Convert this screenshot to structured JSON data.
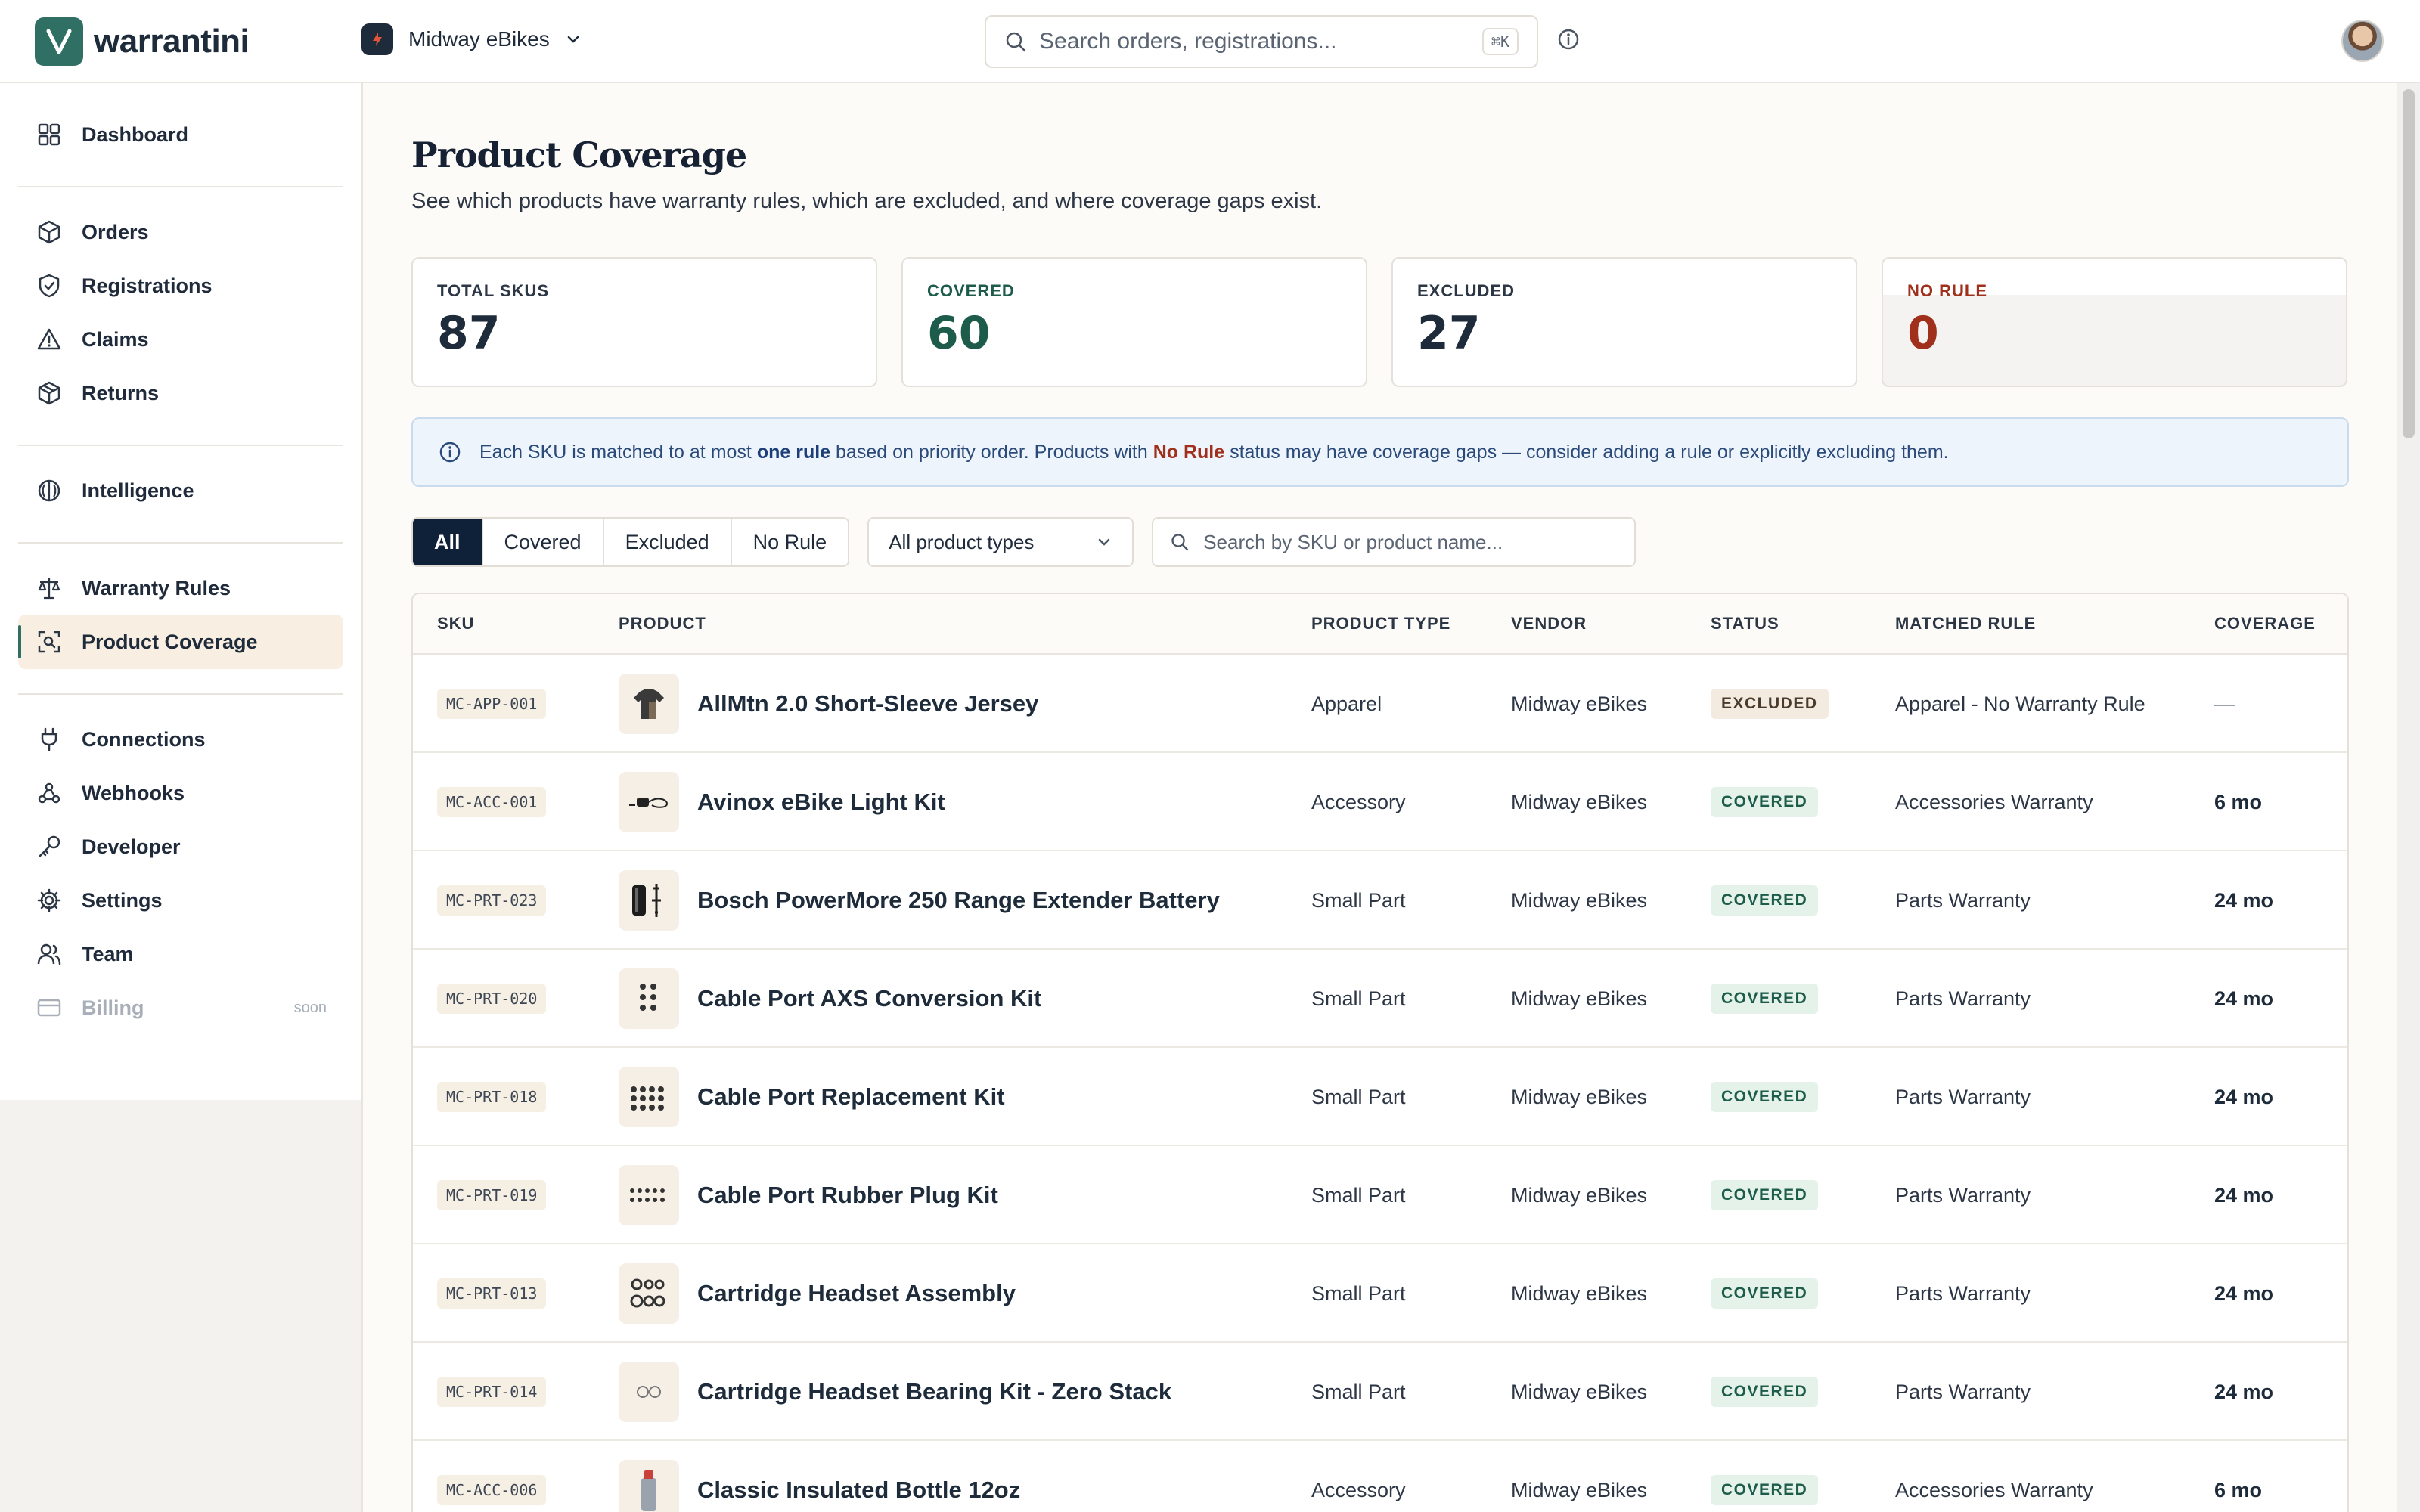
{
  "app": {
    "name": "warrantini"
  },
  "store": {
    "name": "Midway eBikes"
  },
  "search": {
    "placeholder": "Search orders, registrations...",
    "shortcut": "⌘K"
  },
  "sidebar": {
    "items": [
      {
        "label": "Dashboard",
        "icon": "grid-icon"
      },
      {
        "label": "Orders",
        "icon": "box-icon"
      },
      {
        "label": "Registrations",
        "icon": "shield-check-icon"
      },
      {
        "label": "Claims",
        "icon": "warning-icon"
      },
      {
        "label": "Returns",
        "icon": "package-return-icon"
      },
      {
        "label": "Intelligence",
        "icon": "brain-icon"
      },
      {
        "label": "Warranty Rules",
        "icon": "scale-icon"
      },
      {
        "label": "Product Coverage",
        "icon": "scan-search-icon",
        "active": true
      },
      {
        "label": "Connections",
        "icon": "plug-icon"
      },
      {
        "label": "Webhooks",
        "icon": "webhook-icon"
      },
      {
        "label": "Developer",
        "icon": "key-icon"
      },
      {
        "label": "Settings",
        "icon": "gear-icon"
      },
      {
        "label": "Team",
        "icon": "users-icon"
      },
      {
        "label": "Billing",
        "icon": "credit-card-icon",
        "badge": "soon",
        "disabled": true
      }
    ]
  },
  "page": {
    "title": "Product Coverage",
    "subtitle": "See which products have warranty rules, which are excluded, and where coverage gaps exist."
  },
  "stats": [
    {
      "label": "TOTAL SKUS",
      "value": "87"
    },
    {
      "label": "COVERED",
      "value": "60"
    },
    {
      "label": "EXCLUDED",
      "value": "27"
    },
    {
      "label": "NO RULE",
      "value": "0"
    }
  ],
  "notice": {
    "part1": "Each SKU is matched to at most ",
    "bold1": "one rule",
    "part2": " based on priority order. Products with ",
    "bold2": "No Rule",
    "part3": " status may have coverage gaps — consider adding a rule or explicitly excluding them."
  },
  "filters": {
    "tabs": [
      "All",
      "Covered",
      "Excluded",
      "No Rule"
    ],
    "product_type": "All product types",
    "sku_search_placeholder": "Search by SKU or product name..."
  },
  "table": {
    "columns": [
      "SKU",
      "PRODUCT",
      "PRODUCT TYPE",
      "VENDOR",
      "STATUS",
      "MATCHED RULE",
      "COVERAGE"
    ],
    "rows": [
      {
        "sku": "MC-APP-001",
        "product": "AllMtn 2.0 Short-Sleeve Jersey",
        "type": "Apparel",
        "vendor": "Midway eBikes",
        "status": "EXCLUDED",
        "rule": "Apparel - No Warranty Rule",
        "coverage": "—"
      },
      {
        "sku": "MC-ACC-001",
        "product": "Avinox eBike Light Kit",
        "type": "Accessory",
        "vendor": "Midway eBikes",
        "status": "COVERED",
        "rule": "Accessories Warranty",
        "coverage": "6 mo"
      },
      {
        "sku": "MC-PRT-023",
        "product": "Bosch PowerMore 250 Range Extender Battery",
        "type": "Small Part",
        "vendor": "Midway eBikes",
        "status": "COVERED",
        "rule": "Parts Warranty",
        "coverage": "24 mo"
      },
      {
        "sku": "MC-PRT-020",
        "product": "Cable Port AXS Conversion Kit",
        "type": "Small Part",
        "vendor": "Midway eBikes",
        "status": "COVERED",
        "rule": "Parts Warranty",
        "coverage": "24 mo"
      },
      {
        "sku": "MC-PRT-018",
        "product": "Cable Port Replacement Kit",
        "type": "Small Part",
        "vendor": "Midway eBikes",
        "status": "COVERED",
        "rule": "Parts Warranty",
        "coverage": "24 mo"
      },
      {
        "sku": "MC-PRT-019",
        "product": "Cable Port Rubber Plug Kit",
        "type": "Small Part",
        "vendor": "Midway eBikes",
        "status": "COVERED",
        "rule": "Parts Warranty",
        "coverage": "24 mo"
      },
      {
        "sku": "MC-PRT-013",
        "product": "Cartridge Headset Assembly",
        "type": "Small Part",
        "vendor": "Midway eBikes",
        "status": "COVERED",
        "rule": "Parts Warranty",
        "coverage": "24 mo"
      },
      {
        "sku": "MC-PRT-014",
        "product": "Cartridge Headset Bearing Kit - Zero Stack",
        "type": "Small Part",
        "vendor": "Midway eBikes",
        "status": "COVERED",
        "rule": "Parts Warranty",
        "coverage": "24 mo"
      },
      {
        "sku": "MC-ACC-006",
        "product": "Classic Insulated Bottle 12oz",
        "type": "Accessory",
        "vendor": "Midway eBikes",
        "status": "COVERED",
        "rule": "Accessories Warranty",
        "coverage": "6 mo"
      }
    ]
  },
  "colors": {
    "accent": "#2f6f64",
    "navy": "#0f2138",
    "covered": "#1d5c4a",
    "no_rule": "#a0301c"
  }
}
